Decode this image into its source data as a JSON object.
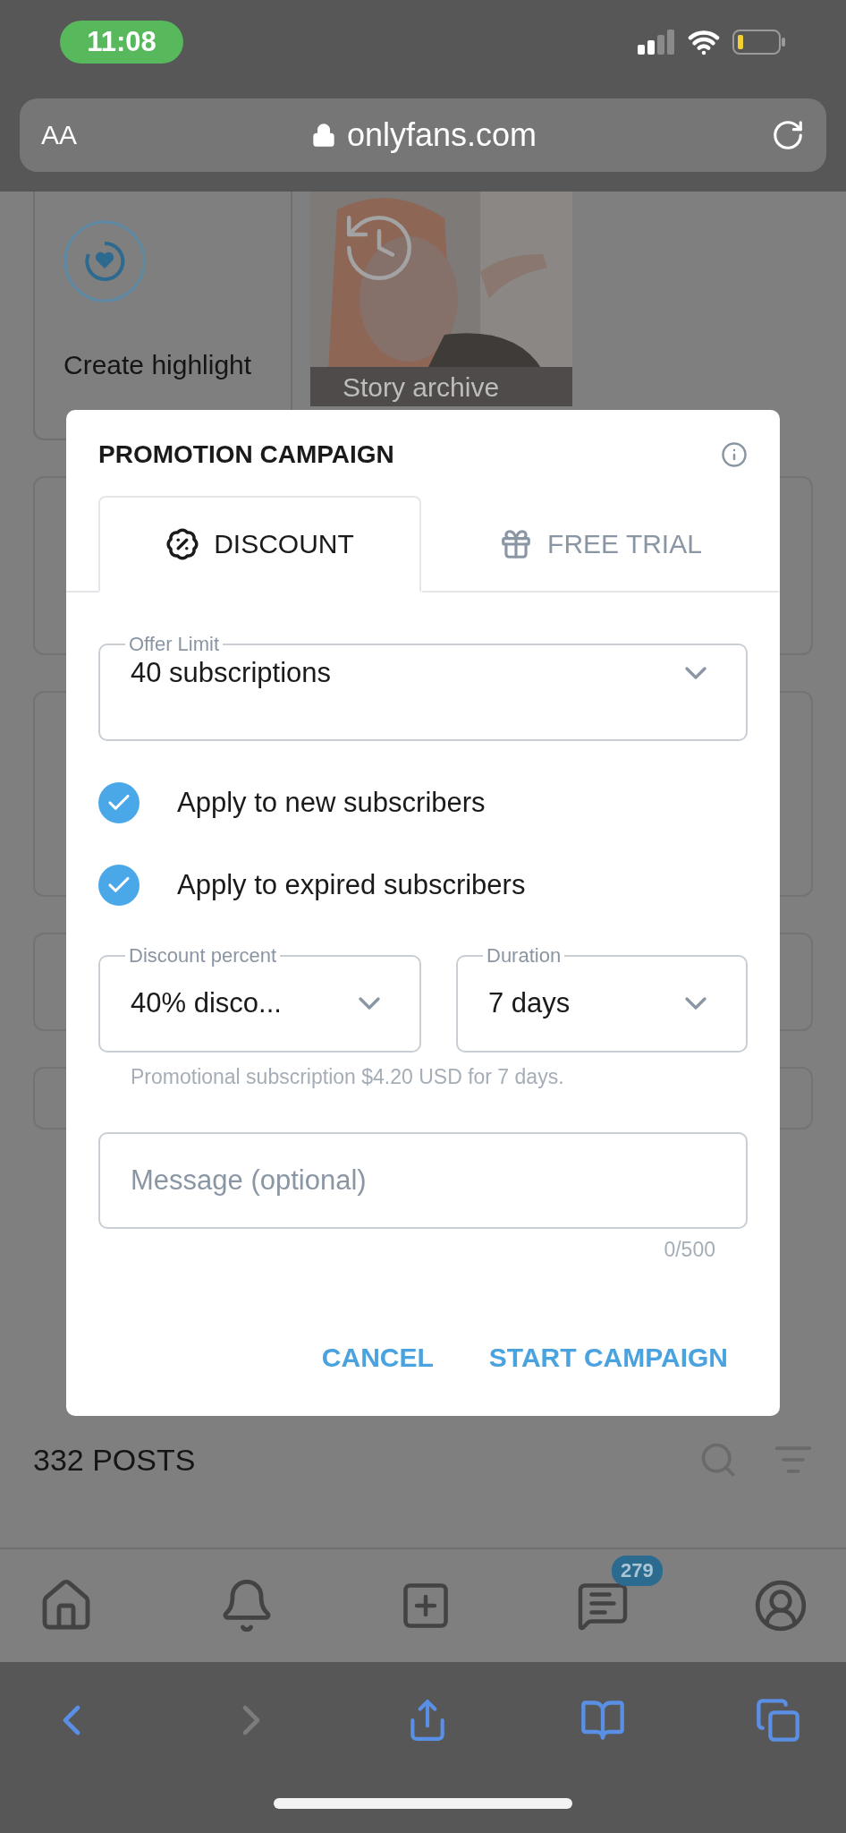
{
  "status_bar": {
    "time": "11:08"
  },
  "address_bar": {
    "text_size_label": "AA",
    "url": "onlyfans.com"
  },
  "highlights": [
    {
      "kind": "create",
      "label": "Create highlight"
    },
    {
      "kind": "archive",
      "label": "Story archive"
    }
  ],
  "posts_header": {
    "count": "332 POSTS"
  },
  "modal": {
    "title": "PROMOTION CAMPAIGN",
    "tabs": [
      {
        "kind": "discount",
        "label": "DISCOUNT",
        "selected": true
      },
      {
        "kind": "trial",
        "label": "FREE TRIAL",
        "selected": false
      }
    ],
    "offer_limit": {
      "label": "Offer Limit",
      "value": "40 subscriptions"
    },
    "options": [
      {
        "label": "Apply to new subscribers",
        "checked": true
      },
      {
        "label": "Apply to expired subscribers",
        "checked": true
      }
    ],
    "discount_percent": {
      "label": "Discount percent",
      "value": "40% disco..."
    },
    "duration": {
      "label": "Duration",
      "value": "7 days"
    },
    "helper_text": "Promotional subscription $4.20 USD for 7 days.",
    "message": {
      "placeholder": "Message (optional)",
      "counter": "0/500"
    },
    "buttons": [
      {
        "label": "CANCEL"
      },
      {
        "label": "START CAMPAIGN"
      }
    ]
  },
  "bottom_nav": {
    "messages_badge": "279"
  },
  "browser_toolbar": {
    "back": {
      "disabled": false
    },
    "forward": {
      "disabled": true
    }
  }
}
